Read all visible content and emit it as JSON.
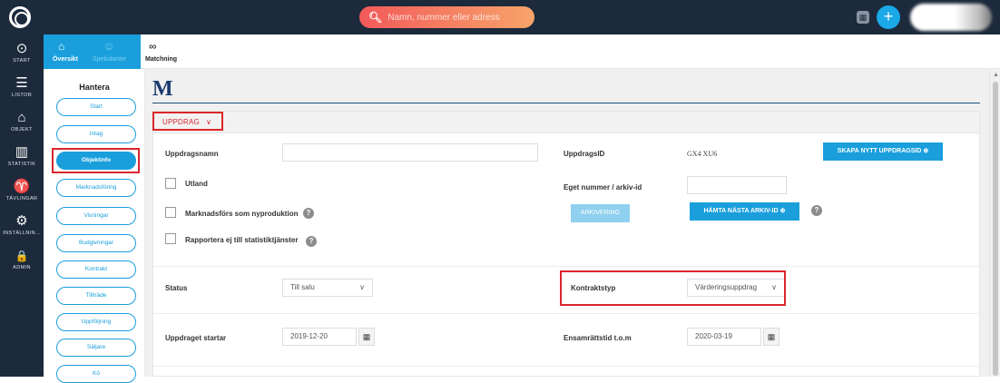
{
  "topbar": {
    "search_placeholder": "Namn, nummer eller adress",
    "add_label": "+",
    "calendar_label": "▦"
  },
  "sidenav": {
    "items": [
      {
        "label": "START",
        "icon": "speedometer-icon",
        "glyph": "⊙"
      },
      {
        "label": "LISTOR",
        "icon": "list-icon",
        "glyph": "☰"
      },
      {
        "label": "OBJEKT",
        "icon": "house-icon",
        "glyph": "⌂"
      },
      {
        "label": "STATISTIK",
        "icon": "bar-chart-icon",
        "glyph": "▥"
      },
      {
        "label": "TÄVLINGAR",
        "icon": "trophy-icon",
        "glyph": "♈"
      },
      {
        "label": "INSTÄLLNIN...",
        "icon": "gear-icon",
        "glyph": "⚙"
      },
      {
        "label": "ADMIN",
        "icon": "lock-icon",
        "glyph": "🔒"
      }
    ]
  },
  "tabs": {
    "oversikt": "Översikt",
    "spekulanter": "Spekulanter",
    "matchning": "Matchning"
  },
  "submenu": {
    "title": "Hantera",
    "items": [
      "Start",
      "Intag",
      "Objektinfo",
      "Marknadsföring",
      "Visningar",
      "Budgivningar",
      "Kontrakt",
      "Tillträde",
      "Uppföljning",
      "Säljare",
      "Kö"
    ],
    "active": "Objektinfo"
  },
  "main": {
    "brand": "M",
    "section_title": "UPPDRAG",
    "uppdragsnamn_label": "Uppdragsnamn",
    "uppdragsnamn_value": "",
    "uppdragsid_label": "UppdragsID",
    "uppdragsid_value": "GX4 XU6",
    "new_id_button": "SKAPA NYTT UPPDRAGSID",
    "utland_label": "Utland",
    "eget_nummer_label": "Eget nummer / arkiv-id",
    "eget_nummer_value": "",
    "nyproduktion_label": "Marknadsförs som nyproduktion",
    "arkivering_button": "ARKIVERING",
    "next_archive_button": "HÄMTA NÄSTA ARKIV-ID",
    "rapportera_label": "Rapportera ej till statistiktjänster",
    "status_label": "Status",
    "status_value": "Till salu",
    "kontraktstyp_label": "Kontraktstyp",
    "kontraktstyp_value": "Värderingsuppdrag",
    "startar_label": "Uppdraget startar",
    "startar_value": "2019-12-20",
    "ensamratt_label": "Ensamrättstid t.o.m",
    "ensamratt_value": "2020-03-19"
  },
  "colors": {
    "nav_bg": "#1c2a3c",
    "accent": "#1a9fdc",
    "highlight": "#d9262c"
  }
}
